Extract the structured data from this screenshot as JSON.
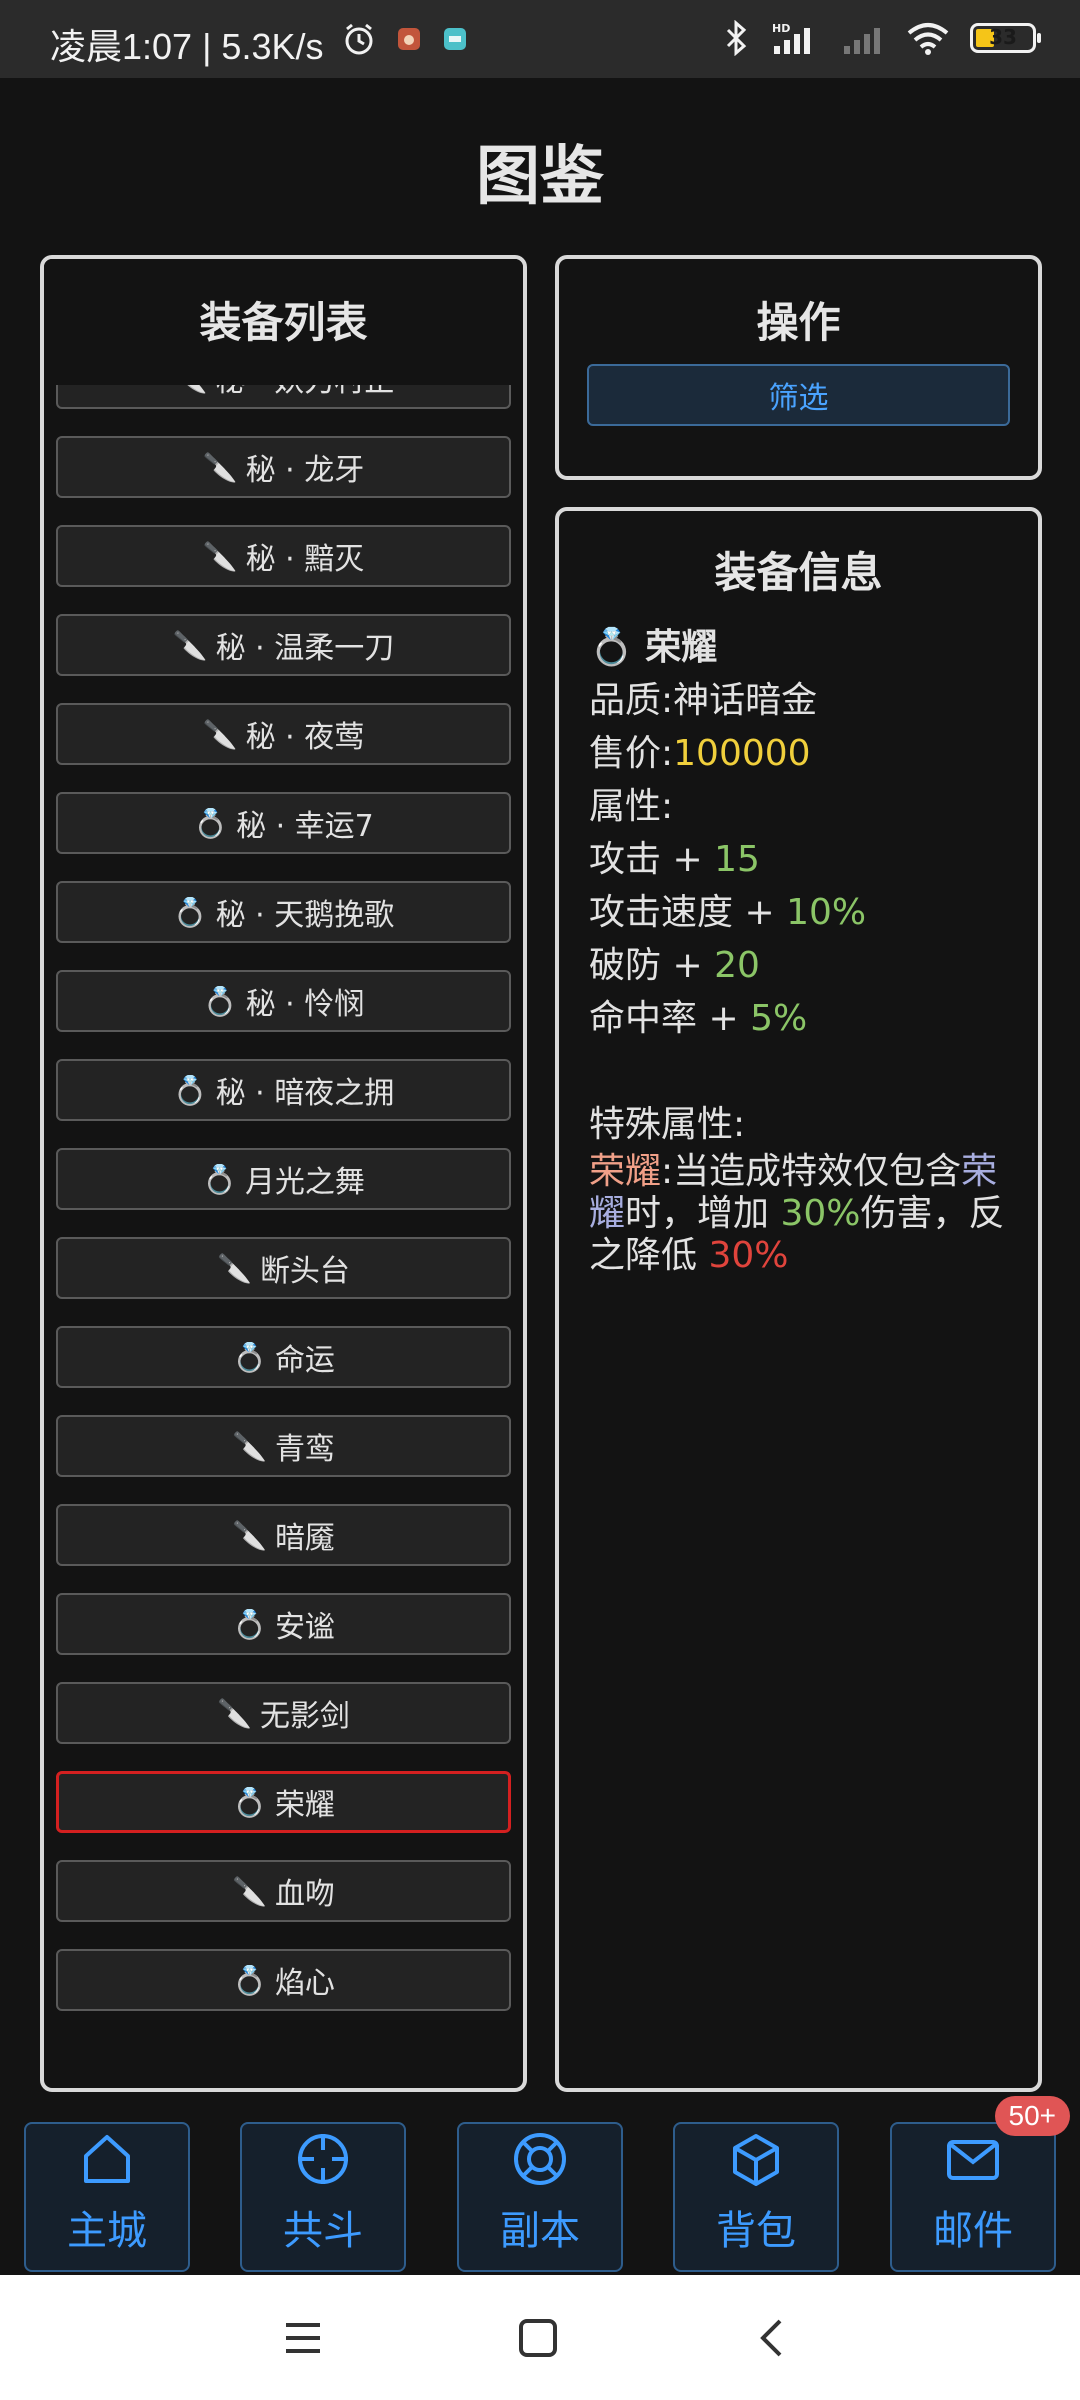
{
  "status_bar": {
    "time": "凌晨1:07 | 5.3K/s",
    "battery": "33",
    "icons": [
      "alarm-icon",
      "app-icon",
      "app-icon",
      "bluetooth-icon",
      "signal-hd-icon",
      "signal-icon",
      "wifi-icon",
      "battery-icon"
    ]
  },
  "page": {
    "title": "图鉴"
  },
  "equipment_list": {
    "title": "装备列表",
    "items": [
      {
        "label": "秘 · 妖刀村正",
        "icon": "knife-icon"
      },
      {
        "label": "秘 · 龙牙",
        "icon": "knife-icon"
      },
      {
        "label": "秘 · 黯灭",
        "icon": "knife-icon"
      },
      {
        "label": "秘 · 温柔一刀",
        "icon": "knife-icon"
      },
      {
        "label": "秘 · 夜莺",
        "icon": "knife-icon"
      },
      {
        "label": "秘 · 幸运7",
        "icon": "ring-icon"
      },
      {
        "label": "秘 · 天鹅挽歌",
        "icon": "ring-icon"
      },
      {
        "label": "秘 · 怜悯",
        "icon": "ring-icon"
      },
      {
        "label": "秘 · 暗夜之拥",
        "icon": "ring-icon"
      },
      {
        "label": "月光之舞",
        "icon": "ring-icon"
      },
      {
        "label": "断头台",
        "icon": "knife-icon"
      },
      {
        "label": "命运",
        "icon": "ring-icon"
      },
      {
        "label": "青鸾",
        "icon": "knife-icon"
      },
      {
        "label": "暗魇",
        "icon": "knife-icon"
      },
      {
        "label": "安谧",
        "icon": "ring-icon"
      },
      {
        "label": "无影剑",
        "icon": "knife-icon"
      },
      {
        "label": "荣耀",
        "icon": "ring-icon",
        "selected": true
      },
      {
        "label": "血吻",
        "icon": "knife-icon"
      },
      {
        "label": "焰心",
        "icon": "ring-icon"
      }
    ]
  },
  "operations": {
    "title": "操作",
    "filter_label": "筛选"
  },
  "equipment_info": {
    "title": "装备信息",
    "name": "荣耀",
    "icon": "ring-icon",
    "quality_label": "品质:",
    "quality_value": "神话暗金",
    "price_label": "售价:",
    "price_value": "100000",
    "attributes_label": "属性:",
    "attributes": [
      {
        "name": "攻击",
        "op": " + ",
        "value": "15"
      },
      {
        "name": "攻击速度",
        "op": " + ",
        "value": "10%"
      },
      {
        "name": "破防",
        "op": " + ",
        "value": "20"
      },
      {
        "name": "命中率",
        "op": " + ",
        "value": "5%"
      }
    ],
    "special_label": "特殊属性:",
    "special": {
      "p1": "荣耀",
      "p2": ":当造成特效仅包含",
      "p3": "荣耀",
      "p4": "时，增加 ",
      "p5": "30%",
      "p6": "伤害，反之降低 ",
      "p7": "30%"
    },
    "colors": {
      "price": "#f0cf3c",
      "bonus": "#8bc567",
      "penalty": "#e0443c"
    }
  },
  "bottom_nav": {
    "items": [
      {
        "label": "主城",
        "icon": "home-icon"
      },
      {
        "label": "共斗",
        "icon": "crosshair-icon"
      },
      {
        "label": "副本",
        "icon": "lifebuoy-icon"
      },
      {
        "label": "背包",
        "icon": "box-icon"
      },
      {
        "label": "邮件",
        "icon": "mail-icon",
        "badge": "50+"
      }
    ],
    "accent": "#3d9bff"
  },
  "system_nav": {
    "icons": [
      "menu-icon",
      "home-square-icon",
      "back-icon"
    ]
  }
}
